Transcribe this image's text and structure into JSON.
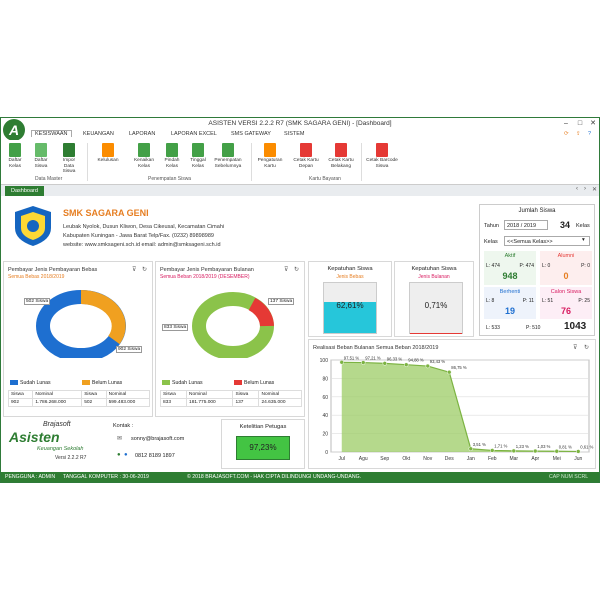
{
  "window": {
    "title": "ASISTEN VERSI 2.2.2 R7 (SMK SAGARA GENI) - [Dashboard]",
    "logo_letter": "A"
  },
  "menu_tabs": [
    "KESISWAAN",
    "KEUANGAN",
    "LAPORAN",
    "LAPORAN EXCEL",
    "SMS GATEWAY",
    "SISTEM"
  ],
  "ribbon": {
    "buttons": [
      "Daftar Kelas",
      "Daftar Siswa",
      "Impor Data Siswa",
      "Kelulusan",
      "Kenaikan Kelas",
      "Pindah Kelas",
      "Tinggal Kelas",
      "Penempatan Sebelumnya",
      "Pengaturan Kartu",
      "Cetak Kartu Depan",
      "Cetak Kartu Belakang",
      "Cetak Barcode Siswa"
    ],
    "groups": [
      "Data Master",
      "Penempatan Siswa",
      "Kartu Bayaran"
    ]
  },
  "doc_tab": "Dashboard",
  "school": {
    "name": "SMK SAGARA GENI",
    "address1": "Leubak Nyolok, Dusun Kliwon, Desa Cikeusal, Kecamatan Cimahi",
    "address2": "Kabupaten Kuningan - Jawa Barat Telp/Fax. (0232) 89898989",
    "website": "website: www.smksageni.sch.id   email: admin@smksageni.sch.id"
  },
  "students": {
    "title": "Jumlah Siswa",
    "tahun_label": "Tahun",
    "tahun": "2018 / 2019",
    "kelas_count": "34",
    "kelas_unit": "Kelas",
    "kelas_label": "Kelas",
    "kelas_select": "<<Semua Kelas>>",
    "aktif": {
      "label": "Aktif",
      "l": "L: 474",
      "p": "P: 474",
      "total": "948"
    },
    "alumni": {
      "label": "Alumni",
      "l": "L: 0",
      "p": "P: 0",
      "total": "0"
    },
    "berhenti": {
      "label": "Berhenti",
      "l": "L: 8",
      "p": "P: 11",
      "total": "19"
    },
    "calon": {
      "label": "Calon Siswa",
      "l": "L: 51",
      "p": "P: 25",
      "total": "76"
    },
    "summary": {
      "l": "L: 533",
      "p": "P: 510",
      "total": "1043"
    }
  },
  "bebas": {
    "title": "Pembayar Jenis Pembayaran Bebas",
    "subtitle": "Semua Bebas 2018/2019",
    "label_a": "502 Siswa",
    "label_b": "902 Siswa",
    "legend_a": "Sudah Lunas",
    "legend_b": "Belum Lunas",
    "table_headers": [
      "Siswa",
      "Nominal",
      "Siswa",
      "Nominal"
    ],
    "table_row": [
      "902",
      "1.786.268.000",
      "502",
      "599.483.000"
    ]
  },
  "bulanan": {
    "title": "Pembayar Jenis Pembayaran Bulanan",
    "subtitle": "Semua Beban 2018/2019 (DESEMBER)",
    "label_a": "833 Siswa",
    "label_b": "137 Siswa",
    "legend_a": "Sudah Lunas",
    "legend_b": "Belum Lunas",
    "table_headers": [
      "Siswa",
      "Nominal",
      "Siswa",
      "Nominal"
    ],
    "table_row": [
      "833",
      "181.775.000",
      "137",
      "24.635.000"
    ]
  },
  "kepatuhan1": {
    "title": "Kepatuhan Siswa",
    "subtitle": "Jenis Bebas",
    "value": "62,61%",
    "fill": 0.6261
  },
  "kepatuhan2": {
    "title": "Kepatuhan Siswa",
    "subtitle": "Jenis Bulanan",
    "value": "0,71%",
    "fill": 0.0071
  },
  "brand": {
    "name": "Brajasoft",
    "app": "Asisten",
    "tagline": "Keuangan Sekolah",
    "version": "Versi 2.2.2 R7"
  },
  "contact": {
    "label": "Kontak :",
    "email": "sonny@brajasoft.com",
    "phone": "0812 8189 1897"
  },
  "ketelitian": {
    "title": "Ketelitian Petugas",
    "value": "97,23%"
  },
  "colors": {
    "green": "#2e7d32",
    "blue": "#1e6fd0",
    "orange": "#f0a020",
    "lime": "#8bc34a",
    "red": "#e53935",
    "cyan": "#26c6da"
  },
  "chart_data": {
    "type": "area",
    "title": "Realisasi Beban Bulanan Semua Beban 2018/2019",
    "categories": [
      "Jul",
      "Agu",
      "Sep",
      "Okt",
      "Nov",
      "Des",
      "Jan",
      "Feb",
      "Mar",
      "Apr",
      "Mei",
      "Jun"
    ],
    "values": [
      97.51,
      97.21,
      96.33,
      94.88,
      93.43,
      86.75,
      3.51,
      1.71,
      1.23,
      1.03,
      0.81,
      0.61
    ],
    "labels": [
      "97,51 %",
      "97,21 %",
      "96,33 %",
      "94,88 %",
      "93,43 %",
      "86,75 %",
      "3,51 %",
      "1,71 %",
      "1,23 %",
      "1,03 %",
      "0,81 %",
      "0,61 %"
    ],
    "yticks": [
      0,
      20,
      40,
      60,
      80,
      100
    ],
    "ylim": [
      0,
      100
    ],
    "grid": true
  },
  "status": {
    "user": "PENGGUNA : ADMIN",
    "date": "TANGGAL KOMPUTER : 30-06-2019",
    "copyright": "© 2018 BRAJASOFT.COM - HAK CIPTA DILINDUNGI UNDANG-UNDANG.",
    "keys": "CAP   NUM   SCRL"
  }
}
